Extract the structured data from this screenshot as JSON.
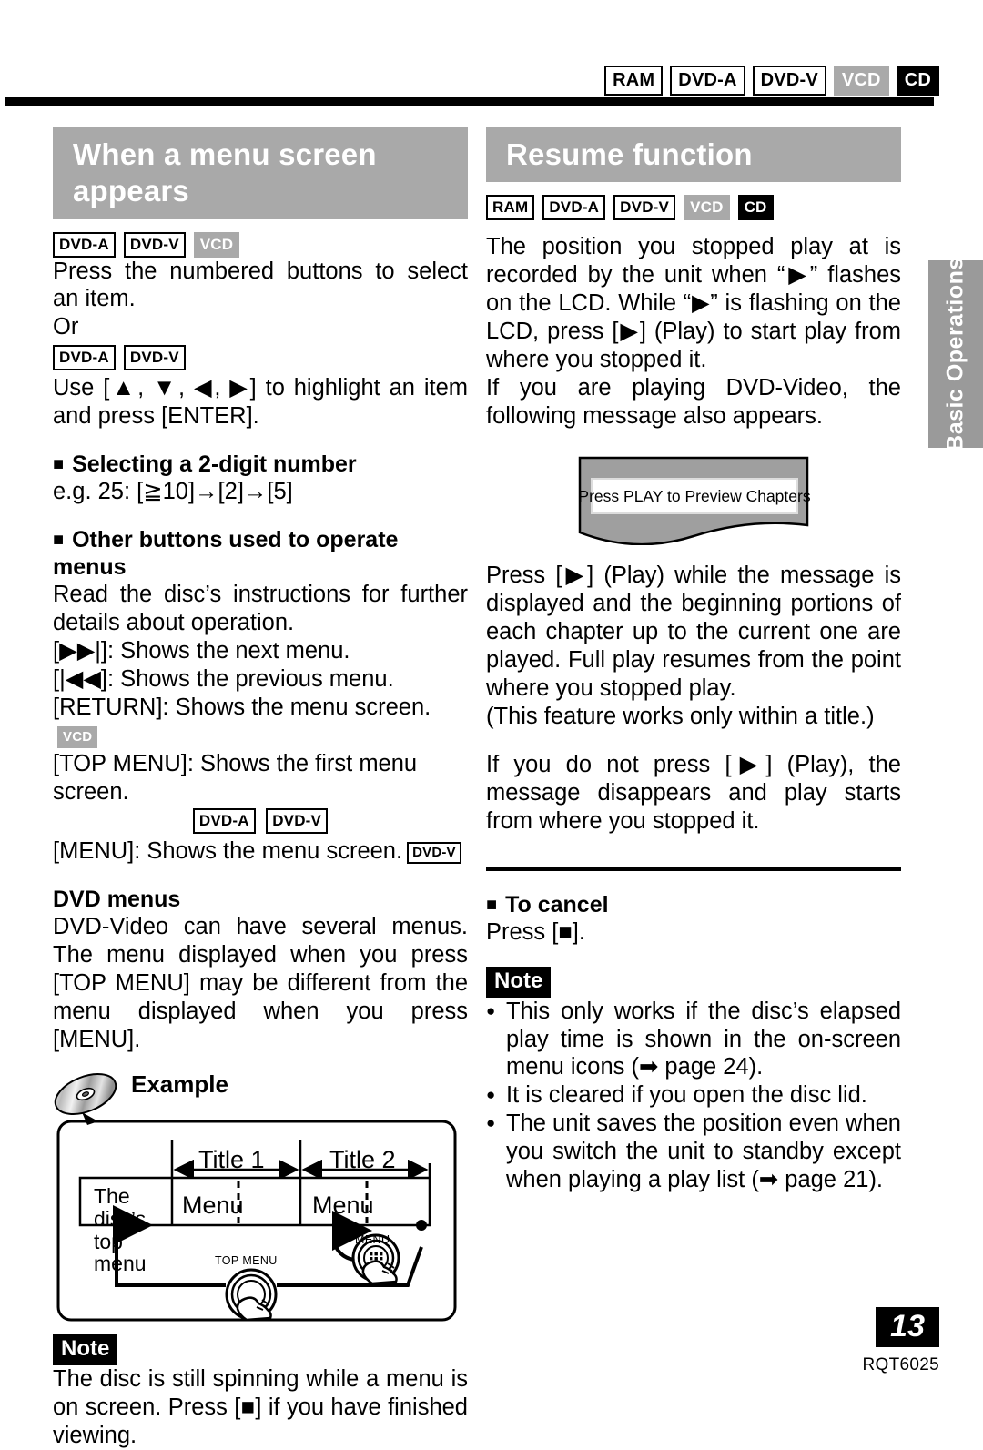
{
  "header": {
    "badges": [
      {
        "label": "RAM",
        "style": "outline"
      },
      {
        "label": "DVD-A",
        "style": "outline"
      },
      {
        "label": "DVD-V",
        "style": "outline"
      },
      {
        "label": "VCD",
        "style": "gray"
      },
      {
        "label": "CD",
        "style": "black"
      }
    ]
  },
  "side_tab": {
    "label": "Basic Operations"
  },
  "left": {
    "title": "When a menu screen appears",
    "badges": [
      {
        "label": "DVD-A",
        "style": "outline"
      },
      {
        "label": "DVD-V",
        "style": "outline"
      },
      {
        "label": "VCD",
        "style": "gray"
      }
    ],
    "para1": "Press the numbered buttons to select an item.",
    "or": "Or",
    "badges2": [
      {
        "label": "DVD-A",
        "style": "outline"
      },
      {
        "label": "DVD-V",
        "style": "outline"
      }
    ],
    "para2": "Use [▲, ▼, ◀, ▶] to highlight an item and press [ENTER].",
    "sub1": "Selecting a 2-digit number",
    "eg": "e.g. 25:  [≧10]→[2]→[5]",
    "sub2": "Other buttons used to operate menus",
    "para3": "Read the disc’s instructions for further details about operation.",
    "btn_next": "[▶▶|]:  Shows the next menu.",
    "btn_prev": "[|◀◀]:  Shows the previous menu.",
    "btn_return": "[RETURN]:  Shows the menu screen.",
    "btn_return_badge": {
      "label": "VCD",
      "style": "gray"
    },
    "btn_topmenu": "[TOP MENU]:  Shows the first menu screen.",
    "topmenu_badges": [
      {
        "label": "DVD-A",
        "style": "outline"
      },
      {
        "label": "DVD-V",
        "style": "outline"
      }
    ],
    "btn_menu": "[MENU]:  Shows the menu screen.",
    "btn_menu_badge": {
      "label": "DVD-V",
      "style": "outline"
    },
    "sub3": "DVD menus",
    "para4": "DVD-Video can have several menus. The menu displayed when you press [TOP MENU] may be different from the menu displayed when you press [MENU].",
    "example": {
      "label": "Example",
      "disc_top_menu": "The disc’s top menu",
      "title1": "Title 1",
      "title2": "Title 2",
      "menu1": "Menu",
      "menu2": "Menu",
      "top_menu_button": "TOP MENU",
      "menu_button": "MENU"
    },
    "note_tag": "Note",
    "note_text": "The disc is still spinning while a menu is on screen. Press [■] if you have finished viewing."
  },
  "right": {
    "title": "Resume function",
    "badges": [
      {
        "label": "RAM",
        "style": "outline"
      },
      {
        "label": "DVD-A",
        "style": "outline"
      },
      {
        "label": "DVD-V",
        "style": "outline"
      },
      {
        "label": "VCD",
        "style": "gray"
      },
      {
        "label": "CD",
        "style": "black"
      }
    ],
    "para1": "The position you stopped play at is recorded by the unit when “▶” flashes on the LCD. While “▶” is flashing on the LCD, press [▶] (Play) to start play from where you stopped it.",
    "para2": "If you are playing DVD-Video, the following message also appears.",
    "screen_message": "Press PLAY to Preview Chapters",
    "para3": "Press [▶] (Play) while the message is displayed and the beginning portions of each chapter up to the current one are played. Full play resumes from the point where you stopped play.",
    "para4": "(This feature works only within a title.)",
    "para5": "If you do not press [▶] (Play), the message disappears and play starts from where you stopped it.",
    "sub_cancel": "To cancel",
    "cancel_text": "Press [■].",
    "note_tag": "Note",
    "notes": [
      "This only works if the disc’s elapsed play time is shown in the on-screen menu icons (➡ page 24).",
      "It is cleared if you open the disc lid.",
      "The unit saves the position even when you switch the unit to standby except when playing a play list (➡ page 21)."
    ]
  },
  "footer": {
    "page_number": "13",
    "doc_code": "RQT6025"
  }
}
